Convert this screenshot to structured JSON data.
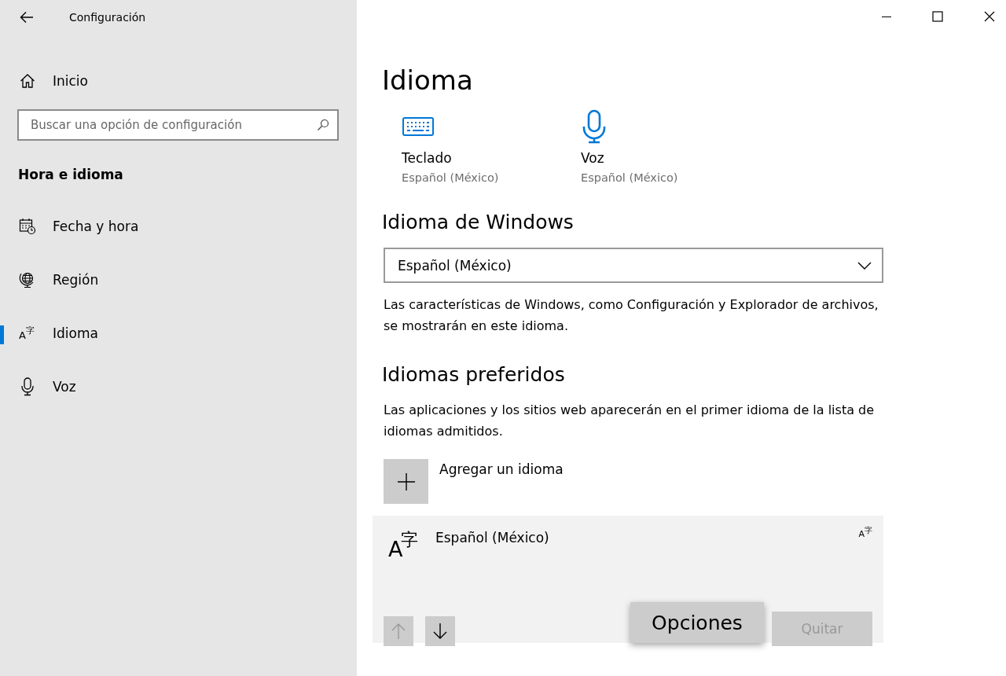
{
  "window": {
    "title": "Configuración"
  },
  "sidebar": {
    "home": "Inicio",
    "search": {
      "placeholder": "Buscar una opción de configuración"
    },
    "section": "Hora e idioma",
    "items": [
      {
        "label": "Fecha y hora",
        "selected": false
      },
      {
        "label": "Región",
        "selected": false
      },
      {
        "label": "Idioma",
        "glyph": [
          "A",
          "字"
        ],
        "selected": true
      },
      {
        "label": "Voz",
        "selected": false
      }
    ]
  },
  "page": {
    "title": "Idioma",
    "shortcuts": [
      {
        "label": "Teclado",
        "value": "Español (México)"
      },
      {
        "label": "Voz",
        "value": "Español (México)"
      }
    ],
    "windows_language": {
      "heading": "Idioma de Windows",
      "dropdown": "Español (México)",
      "description": "Las características de Windows, como Configuración y Explorador de archivos, se mostrarán en este idioma."
    },
    "preferred": {
      "heading": "Idiomas preferidos",
      "description": "Las aplicaciones y los sitios web aparecerán en el primer idioma de la lista de idiomas admitidos.",
      "add_label": "Agregar un idioma",
      "languages": [
        {
          "name": "Español (México)",
          "glyph": [
            "A",
            "字"
          ],
          "feature_glyph": [
            "A",
            "字"
          ],
          "selected": true,
          "buttons": [
            {
              "kind": "up",
              "disabled": true
            },
            {
              "kind": "down",
              "disabled": false
            },
            {
              "kind": "text",
              "label": "Opciones",
              "disabled": false,
              "focused": true
            },
            {
              "kind": "text",
              "label": "Quitar",
              "disabled": true,
              "focused": false
            }
          ]
        }
      ]
    }
  }
}
